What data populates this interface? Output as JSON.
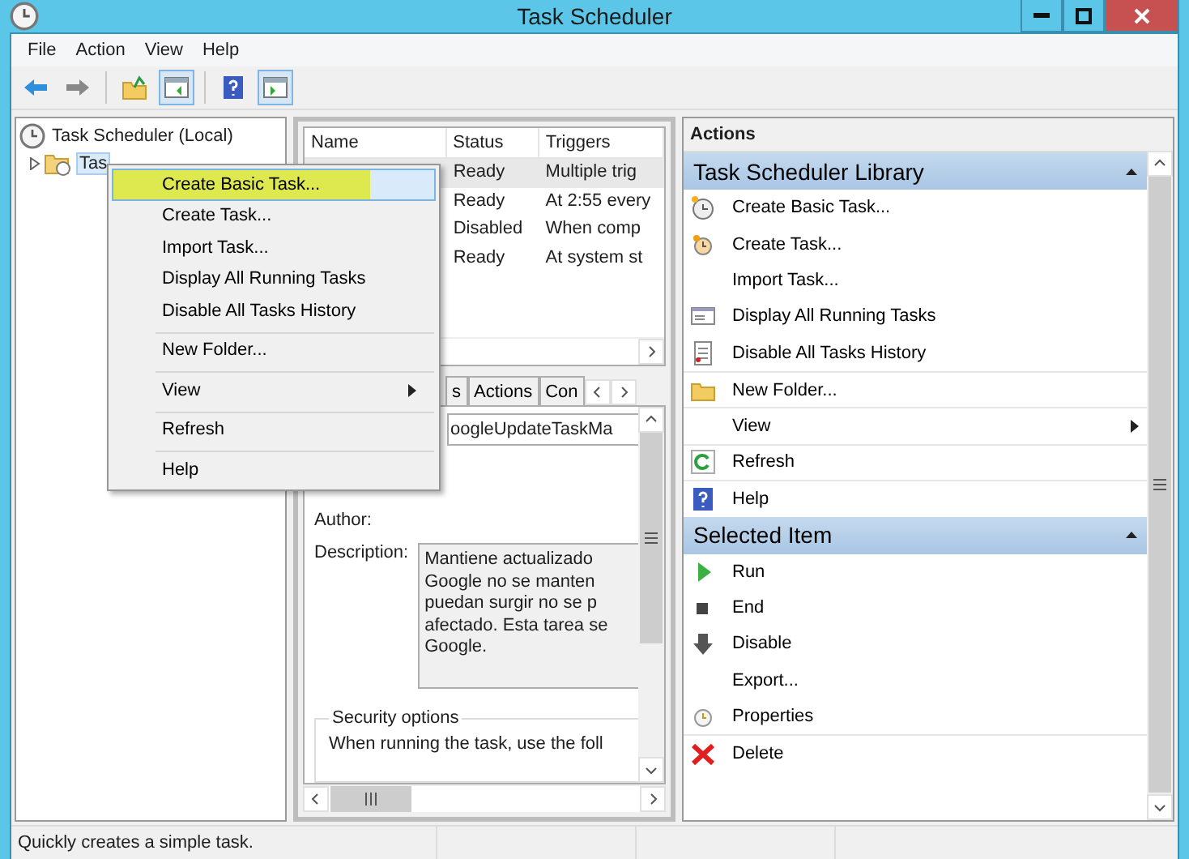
{
  "window": {
    "title": "Task Scheduler"
  },
  "menu_bar": [
    "File",
    "Action",
    "View",
    "Help"
  ],
  "tree": [
    {
      "label": "Task Scheduler (Local)",
      "selected": false,
      "children": [
        {
          "label": "Tas",
          "selected": true,
          "expanded": false
        }
      ]
    }
  ],
  "task_table": {
    "columns": [
      "Name",
      "Status",
      "Triggers"
    ],
    "rows": [
      {
        "status": "Ready",
        "triggers": "Multiple trig",
        "selected": true
      },
      {
        "status": "Ready",
        "triggers": "At 2:55 every",
        "selected": false
      },
      {
        "status": "Disabled",
        "triggers": "When comp",
        "selected": false
      },
      {
        "status": "Ready",
        "triggers": "At system st",
        "selected": false
      }
    ]
  },
  "detail_tabs": [
    {
      "label": "s",
      "selected": false
    },
    {
      "label": "Actions",
      "selected": false
    },
    {
      "label": "Con",
      "selected": false
    }
  ],
  "detail": {
    "name_value": "oogleUpdateTaskMa",
    "author_label": "Author:",
    "description_label": "Description:",
    "description_lines": [
      "Mantiene actualizado",
      "Google no se manten",
      "puedan surgir no se p",
      "afectado. Esta tarea se",
      "Google."
    ],
    "security_title": "Security options",
    "security_text": "When running the task, use the foll"
  },
  "actions_panel": {
    "header": "Actions",
    "sections": [
      {
        "title": "Task Scheduler Library",
        "expanded": true,
        "items": [
          {
            "label": "Create Basic Task...",
            "kind": "plain"
          },
          {
            "label": "Create Task...",
            "kind": "plain"
          },
          {
            "label": "Import Task...",
            "kind": "plain"
          },
          {
            "label": "Display All Running Tasks",
            "kind": "plain"
          },
          {
            "label": "Disable All Tasks History",
            "kind": "plain"
          },
          {
            "label": "New Folder...",
            "kind": "plain"
          },
          {
            "label": "View",
            "kind": "submenu"
          },
          {
            "label": "Refresh",
            "kind": "plain"
          },
          {
            "label": "Help",
            "kind": "plain"
          }
        ]
      },
      {
        "title": "Selected Item",
        "expanded": true,
        "items": [
          {
            "label": "Run",
            "kind": "plain"
          },
          {
            "label": "End",
            "kind": "plain"
          },
          {
            "label": "Disable",
            "kind": "plain"
          },
          {
            "label": "Export...",
            "kind": "plain"
          },
          {
            "label": "Properties",
            "kind": "plain"
          },
          {
            "label": "Delete",
            "kind": "plain"
          }
        ]
      }
    ]
  },
  "context_menu": [
    {
      "label": "Create Basic Task...",
      "kind": "plain",
      "selected": true,
      "separator_before": false
    },
    {
      "label": "Create Task...",
      "kind": "plain",
      "selected": false,
      "separator_before": false
    },
    {
      "label": "Import Task...",
      "kind": "plain",
      "selected": false,
      "separator_before": false
    },
    {
      "label": "Display All Running Tasks",
      "kind": "plain",
      "selected": false,
      "separator_before": false
    },
    {
      "label": "Disable All Tasks History",
      "kind": "plain",
      "selected": false,
      "separator_before": false
    },
    {
      "label": "New Folder...",
      "kind": "plain",
      "selected": false,
      "separator_before": true
    },
    {
      "label": "View",
      "kind": "submenu",
      "selected": false,
      "separator_before": true
    },
    {
      "label": "Refresh",
      "kind": "plain",
      "selected": false,
      "separator_before": true
    },
    {
      "label": "Help",
      "kind": "plain",
      "selected": false,
      "separator_before": true
    }
  ],
  "status_bar": {
    "text": "Quickly creates a simple task."
  }
}
